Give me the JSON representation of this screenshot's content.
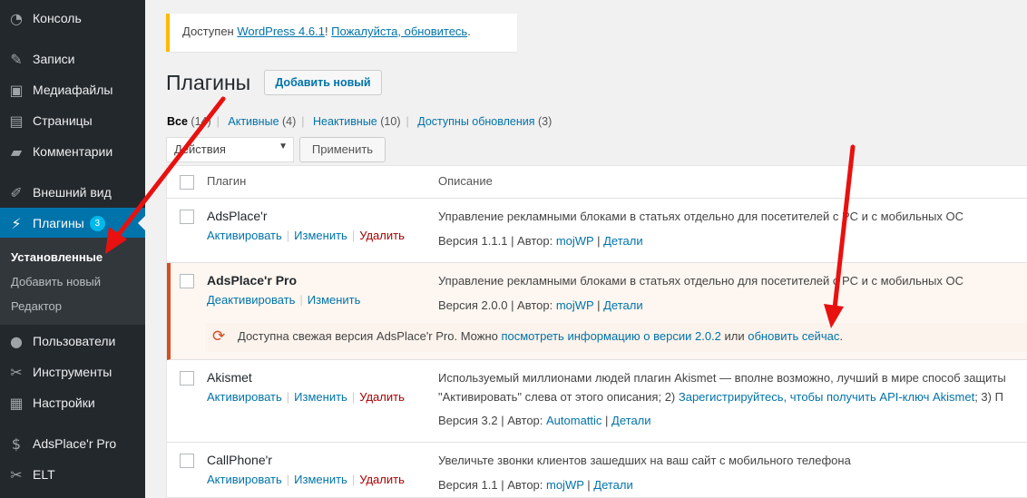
{
  "sidebar": {
    "items": [
      {
        "label": "Консоль",
        "icon": "dashboard-icon"
      },
      {
        "label": "Записи",
        "icon": "pin-icon"
      },
      {
        "label": "Медиафайлы",
        "icon": "media-icon"
      },
      {
        "label": "Страницы",
        "icon": "pages-icon"
      },
      {
        "label": "Комментарии",
        "icon": "comment-icon"
      },
      {
        "label": "Внешний вид",
        "icon": "brush-icon"
      },
      {
        "label": "Плагины",
        "icon": "plugin-icon",
        "badge": "3"
      },
      {
        "label": "Пользователи",
        "icon": "user-icon"
      },
      {
        "label": "Инструменты",
        "icon": "wrench-icon"
      },
      {
        "label": "Настройки",
        "icon": "settings-icon"
      },
      {
        "label": "AdsPlace'r Pro",
        "icon": "dollar-icon"
      },
      {
        "label": "ELT",
        "icon": "tool-icon"
      }
    ],
    "submenu": [
      "Установленные",
      "Добавить новый",
      "Редактор"
    ]
  },
  "notice": {
    "prefix": "Доступен ",
    "link1": "WordPress 4.6.1",
    "mid": "! ",
    "link2": "Пожалуйста, обновитесь",
    "suffix": "."
  },
  "page": {
    "title": "Плагины",
    "add_new": "Добавить новый"
  },
  "filters": {
    "all": "Все",
    "all_count": "(14)",
    "active": "Активные",
    "active_count": "(4)",
    "inactive": "Неактивные",
    "inactive_count": "(10)",
    "updates": "Доступны обновления",
    "updates_count": "(3)"
  },
  "bulk": {
    "select": "Действия",
    "apply": "Применить"
  },
  "table": {
    "col_plugin": "Плагин",
    "col_desc": "Описание",
    "rows": [
      {
        "name": "AdsPlace'r",
        "a1": "Активировать",
        "a2": "Изменить",
        "a3": "Удалить",
        "desc": "Управление рекламными блоками в статьях отдельно для посетителей с PC и с мобильных ОС",
        "ver": "Версия 1.1.1 | Автор: ",
        "author": "mojWP",
        "details": "Детали"
      },
      {
        "name": "AdsPlace'r Pro",
        "a1": "Деактивировать",
        "a2": "Изменить",
        "desc": "Управление рекламными блоками в статьях отдельно для посетителей с PC и с мобильных ОС",
        "ver": "Версия 2.0.0 | Автор: ",
        "author": "mojWP",
        "details": "Детали",
        "update": {
          "text": "Доступна свежая версия AdsPlace'r Pro. Можно ",
          "link1": "посмотреть информацию о версии 2.0.2",
          "mid": " или ",
          "link2": "обновить сейчас",
          "end": "."
        }
      },
      {
        "name": "Akismet",
        "a1": "Активировать",
        "a2": "Изменить",
        "a3": "Удалить",
        "desc": "Используемый миллионами людей плагин Akismet — вполне возможно, лучший в мире способ защиты",
        "desc2": "\"Активировать\" слева от этого описания; 2) ",
        "desc2link": "Зарегистрируйтесь, чтобы получить API-ключ Akismet",
        "desc2end": "; 3) П",
        "ver": "Версия 3.2 | Автор: ",
        "author": "Automattic",
        "details": "Детали"
      },
      {
        "name": "CallPhone'r",
        "a1": "Активировать",
        "a2": "Изменить",
        "a3": "Удалить",
        "desc": "Увеличьте звонки клиентов зашедших на ваш сайт с мобильного телефона",
        "ver": "Версия 1.1 | Автор: ",
        "author": "mojWP",
        "details": "Детали"
      }
    ]
  },
  "colors": {
    "sidebar": "#23282d",
    "active": "#0073aa",
    "link": "#0073aa",
    "arrow": "#e8110f"
  }
}
